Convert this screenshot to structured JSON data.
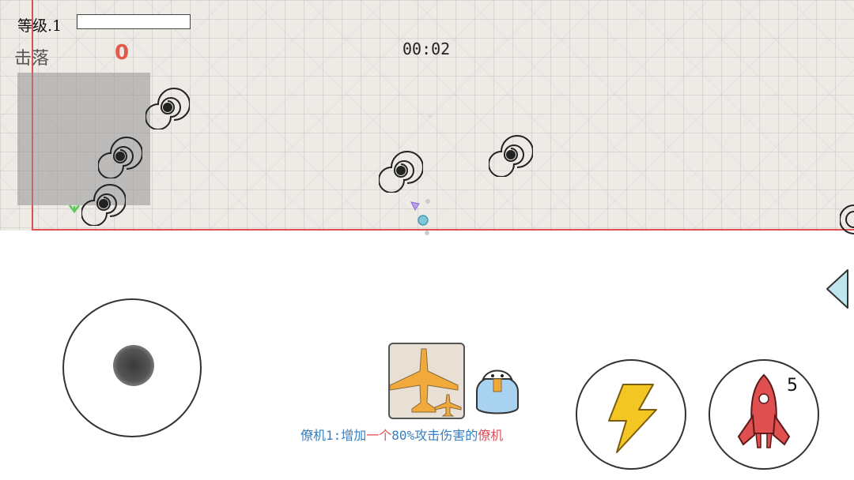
{
  "hud": {
    "level_label": "等级.1",
    "xp_fraction": 0,
    "kills_label": "击落",
    "kills_count": "0",
    "timer": "00:02"
  },
  "skill": {
    "rocket_count": "5"
  },
  "tip": {
    "part1": "僚机1:增加",
    "part2": "一个",
    "part3": "80%攻击伤害的",
    "part4": "僚机"
  },
  "icons": {
    "joystick": "joystick-icon",
    "wingman": "wingman-plane-icon",
    "helmet": "pilot-helmet-icon",
    "lightning": "lightning-icon",
    "rocket": "rocket-icon",
    "side": "triangle-left-icon",
    "enemy": "vortex-icon"
  },
  "colors": {
    "arena_border": "#e05050",
    "kills_color": "#e25a4a",
    "tip_text": "#3a7fbf",
    "tip_highlight": "#e0505a",
    "lightning": "#f3c623",
    "rocket": "#d94040",
    "wingman": "#f0a93a"
  }
}
